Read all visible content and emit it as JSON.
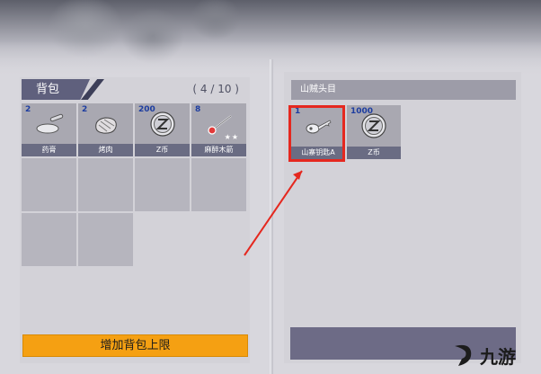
{
  "bag": {
    "title": "背包",
    "count": "( 4 / 10 )",
    "items": [
      {
        "qty": "2",
        "name": "药膏",
        "icon": "ointment-icon"
      },
      {
        "qty": "2",
        "name": "烤肉",
        "icon": "roast-meat-icon"
      },
      {
        "qty": "200",
        "name": "Z币",
        "icon": "z-coin-icon"
      },
      {
        "qty": "8",
        "name": "麻醉木箭",
        "icon": "tranquilizer-arrow-icon",
        "stars": "★★"
      }
    ],
    "expand_label": "增加背包上限"
  },
  "bandit": {
    "title": "山贼头目",
    "items": [
      {
        "qty": "1",
        "name": "山寨钥匙A",
        "icon": "key-icon"
      },
      {
        "qty": "1000",
        "name": "Z币",
        "icon": "z-coin-icon"
      }
    ]
  },
  "watermark": {
    "text": "九游"
  },
  "colors": {
    "accent": "#f5a012",
    "highlight": "#e5281f",
    "tab": "#5f607d",
    "qty": "#1d3da0"
  }
}
